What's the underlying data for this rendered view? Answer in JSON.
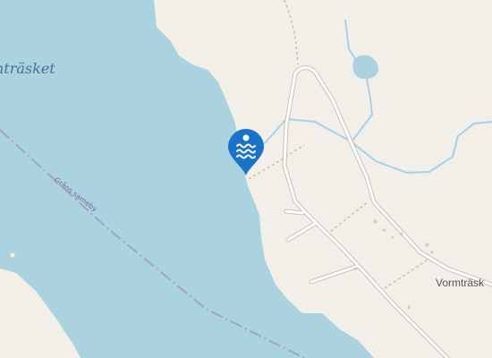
{
  "labels": {
    "lake_name": "nträsket",
    "boundary_name": "Gråns sameby",
    "place_name": "Vormträsk"
  },
  "marker": {
    "icon": "swimming-icon",
    "color": "#1a73c8"
  },
  "colors": {
    "land": "#f2efe9",
    "water": "#aad3df",
    "stream": "#a8d0e8",
    "boundary": "#a3a3bd",
    "track": "#c9b89a",
    "road": "#ffffff"
  }
}
